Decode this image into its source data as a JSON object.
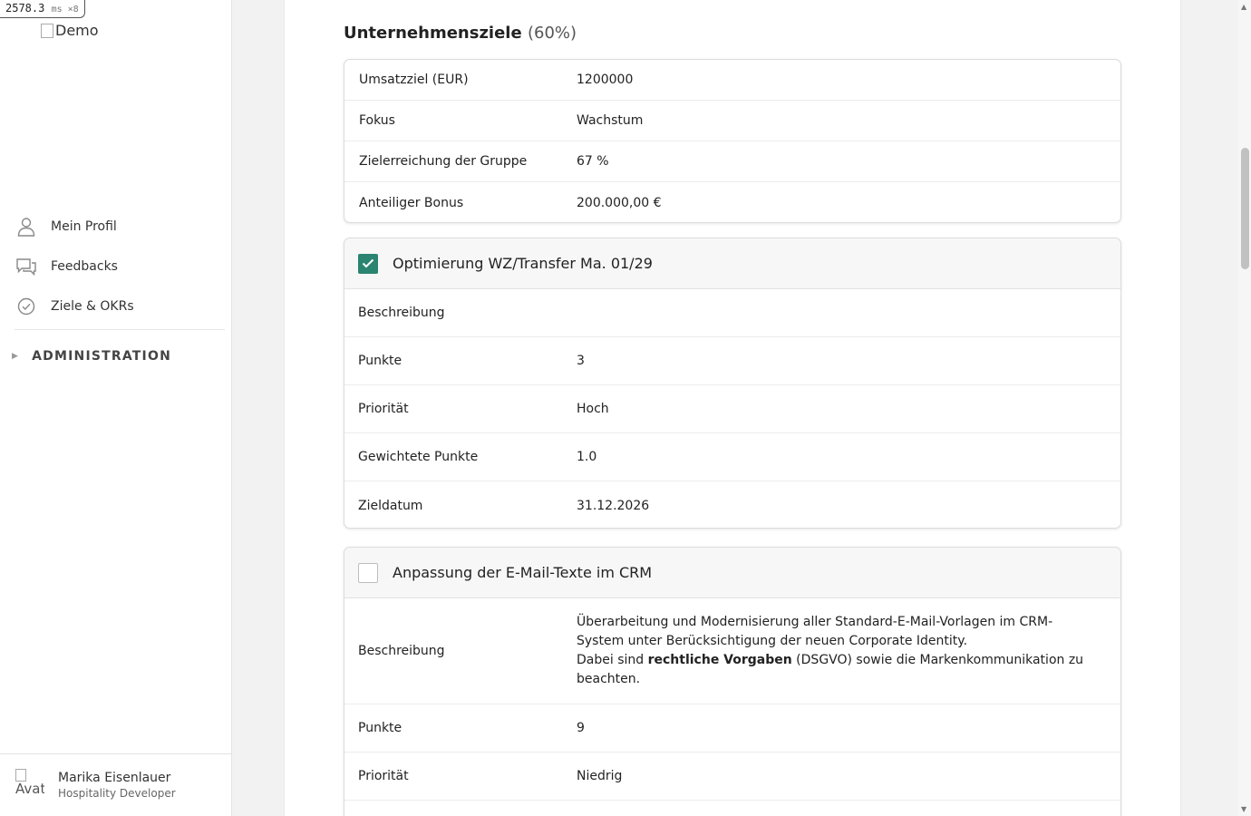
{
  "perf": {
    "value": "2578.3",
    "unit": "ms ×8"
  },
  "sidebar": {
    "logo_alt": "Demo",
    "items": [
      {
        "label": "Mein Profil",
        "icon": "user-icon"
      },
      {
        "label": "Feedbacks",
        "icon": "chat-icon"
      },
      {
        "label": "Ziele & OKRs",
        "icon": "check-circle-icon"
      }
    ],
    "admin": {
      "label": "ADMINISTRATION",
      "icon": "caret-right-icon"
    },
    "user": {
      "avatar_alt": "Avat",
      "name": "Marika Eisenlauer",
      "role": "Hospitality Developer"
    }
  },
  "main": {
    "section": {
      "title": "Unternehmensziele",
      "percent": "(60%)"
    },
    "summary": [
      {
        "label": "Umsatzziel (EUR)",
        "value": "1200000"
      },
      {
        "label": "Fokus",
        "value": "Wachstum"
      },
      {
        "label": "Zielerreichung der Gruppe",
        "value": "67 %"
      },
      {
        "label": "Anteiliger Bonus",
        "value": "200.000,00 €"
      }
    ],
    "goals": [
      {
        "title": "Optimierung WZ/Transfer Ma. 01/29",
        "checked": true,
        "rows": [
          {
            "label": "Beschreibung",
            "value": ""
          },
          {
            "label": "Punkte",
            "value": "3"
          },
          {
            "label": "Priorität",
            "value": "Hoch"
          },
          {
            "label": "Gewichtete Punkte",
            "value": "1.0"
          },
          {
            "label": "Zieldatum",
            "value": "31.12.2026"
          }
        ]
      },
      {
        "title": "Anpassung der E-Mail-Texte im CRM",
        "checked": false,
        "description": {
          "label": "Beschreibung",
          "line1": "Überarbeitung und Modernisierung aller Standard-E-Mail-Vorlagen im CRM-System unter Berücksichtigung der neuen Corporate Identity.",
          "line2_before": "Dabei sind ",
          "line2_bold": "rechtliche Vorgaben",
          "line2_after": " (DSGVO) sowie die Markenkommunikation zu beachten."
        },
        "rows": [
          {
            "label": "Punkte",
            "value": "9"
          },
          {
            "label": "Priorität",
            "value": "Niedrig"
          }
        ]
      }
    ]
  },
  "colors": {
    "checkbox_checked": "#2a8470",
    "sidebar_bg": "#ffffff",
    "page_bg": "#f2f2f2"
  }
}
